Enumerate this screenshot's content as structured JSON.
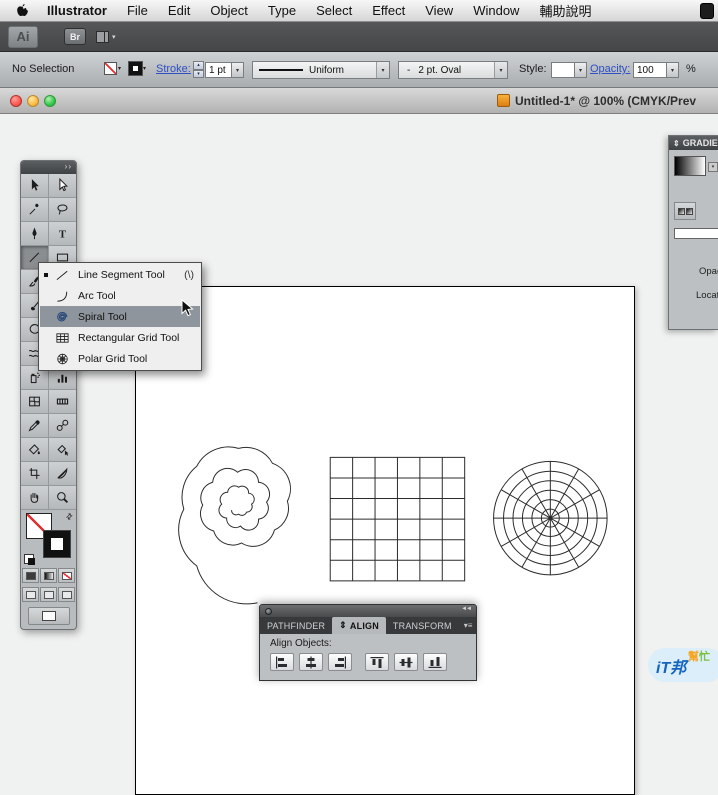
{
  "menubar": {
    "items": [
      "Illustrator",
      "File",
      "Edit",
      "Object",
      "Type",
      "Select",
      "Effect",
      "View",
      "Window",
      "輔助說明"
    ]
  },
  "appbar": {
    "ai_logo": "Ai",
    "bridge_button": "Br"
  },
  "control_bar": {
    "selection_status": "No Selection",
    "stroke_link": "Stroke:",
    "stroke_weight": "1 pt",
    "width_profile": "Uniform",
    "brush_dash": "-",
    "brush_name": "2 pt. Oval",
    "style_label": "Style:",
    "opacity_link": "Opacity:",
    "opacity_value": "100",
    "opacity_unit": "%"
  },
  "window": {
    "title": "Untitled-1* @ 100% (CMYK/Prev"
  },
  "tool_flyout": {
    "selected": "Spiral Tool",
    "items": [
      {
        "label": "Line Segment Tool",
        "shortcut": "(\\)"
      },
      {
        "label": "Arc Tool",
        "shortcut": ""
      },
      {
        "label": "Spiral Tool",
        "shortcut": ""
      },
      {
        "label": "Rectangular Grid Tool",
        "shortcut": ""
      },
      {
        "label": "Polar Grid Tool",
        "shortcut": ""
      }
    ]
  },
  "gradient_panel": {
    "title": "GRADIENT",
    "opacity_label": "Opacity:",
    "location_label": "Location:"
  },
  "align_panel": {
    "tabs": [
      "PATHFINDER",
      "ALIGN",
      "TRANSFORM"
    ],
    "active_tab": "ALIGN",
    "section_label": "Align Objects:"
  },
  "watermark": {
    "primary": "iT邦",
    "secondary": "幫忙"
  },
  "icons": {
    "collapse_arrows": "››",
    "panel_toggle": "⇕",
    "minimize": "◄◄",
    "dropdown": "▾",
    "stepper_up": "▴",
    "stepper_down": "▾",
    "panel_menu": "▾≡"
  },
  "colors": {
    "link_blue": "#2f4fc5",
    "selection_highlight": "#8e959c",
    "artboard_stroke": "#2b2b2b"
  }
}
